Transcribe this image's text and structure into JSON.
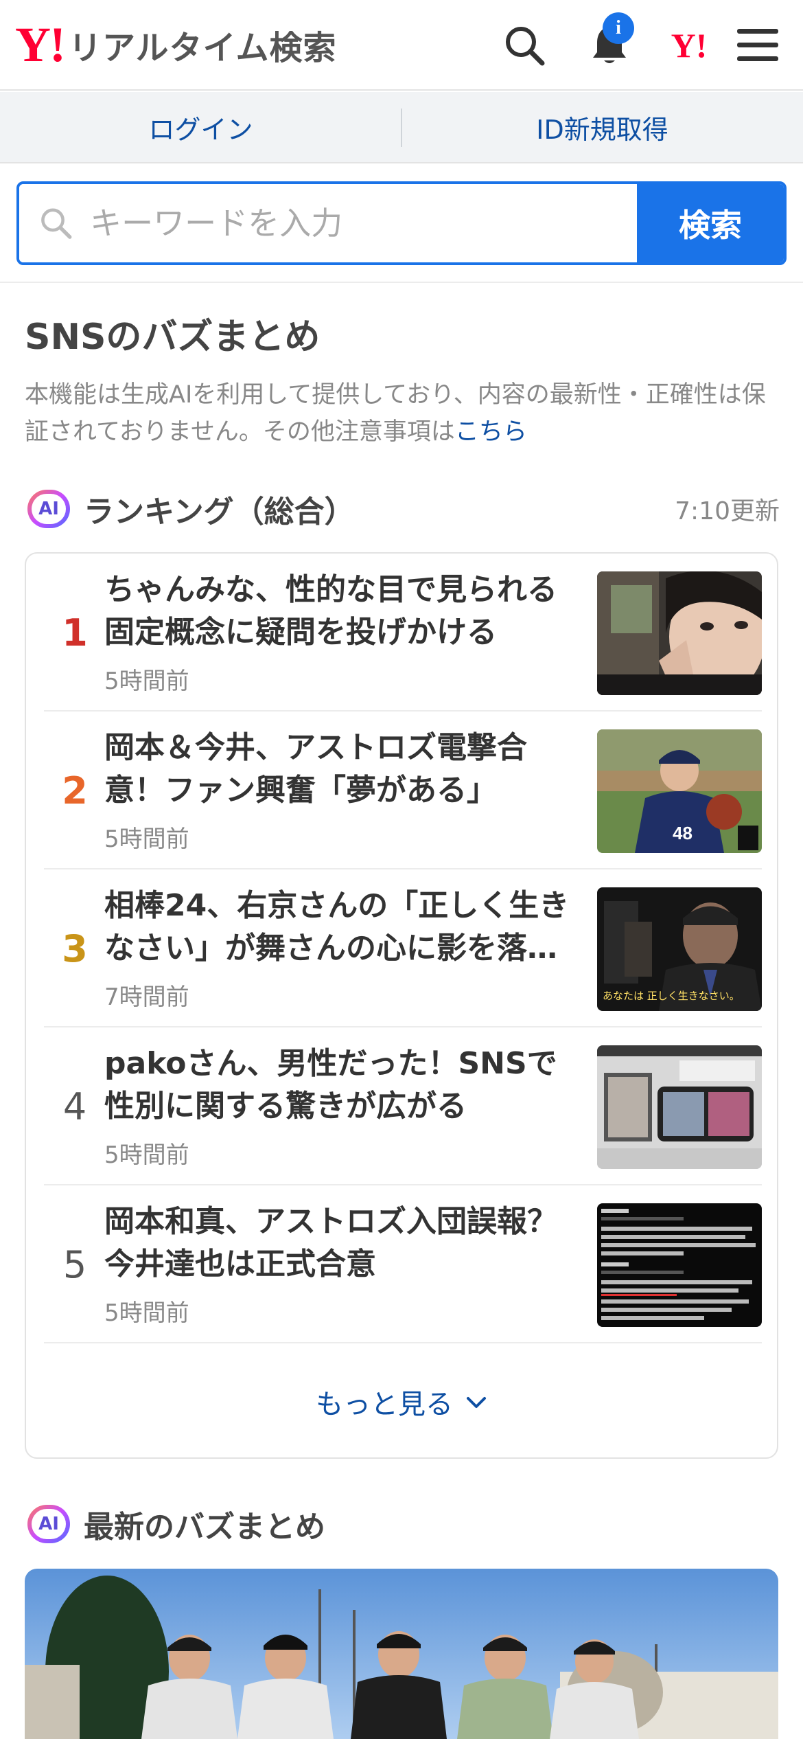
{
  "header": {
    "logo_mark": "Y!",
    "logo_text": "リアルタイム検索",
    "notification_badge": "i",
    "yahoo_mark": "Y!"
  },
  "login_bar": {
    "login_label": "ログイン",
    "register_label": "ID新規取得"
  },
  "search": {
    "placeholder": "キーワードを入力",
    "button_label": "検索"
  },
  "sns_section": {
    "title": "SNSのバズまとめ",
    "notice_text": "本機能は生成AIを利用して提供しており、内容の最新性・正確性は保証されておりません。その他注意事項は",
    "notice_link": "こちら"
  },
  "ranking": {
    "ai_label": "AI",
    "title": "ランキング（総合）",
    "updated": "7:10更新",
    "items": [
      {
        "rank": "1",
        "headline": "ちゃんみな、性的な目で見られる固定概念に疑問を投げかける",
        "time": "5時間前",
        "rank_color": "#d0302a"
      },
      {
        "rank": "2",
        "headline": "岡本＆今井、アストロズ電撃合意！ファン興奮「夢がある」",
        "time": "5時間前",
        "rank_color": "#e8662a"
      },
      {
        "rank": "3",
        "headline": "相棒24、右京さんの「正しく生きなさい」が舞さんの心に影を落…",
        "time": "7時間前",
        "rank_color": "#c99418"
      },
      {
        "rank": "4",
        "headline": "pakoさん、男性だった！SNSで性別に関する驚きが広がる",
        "time": "5時間前",
        "rank_color": "#555555"
      },
      {
        "rank": "5",
        "headline": "岡本和真、アストロズ入団誤報？今井達也は正式合意",
        "time": "5時間前",
        "rank_color": "#555555"
      }
    ],
    "more_label": "もっと見る"
  },
  "thumb3_caption": "あなたは 正しく生きなさい。",
  "latest": {
    "ai_label": "AI",
    "title": "最新のバズまとめ"
  }
}
